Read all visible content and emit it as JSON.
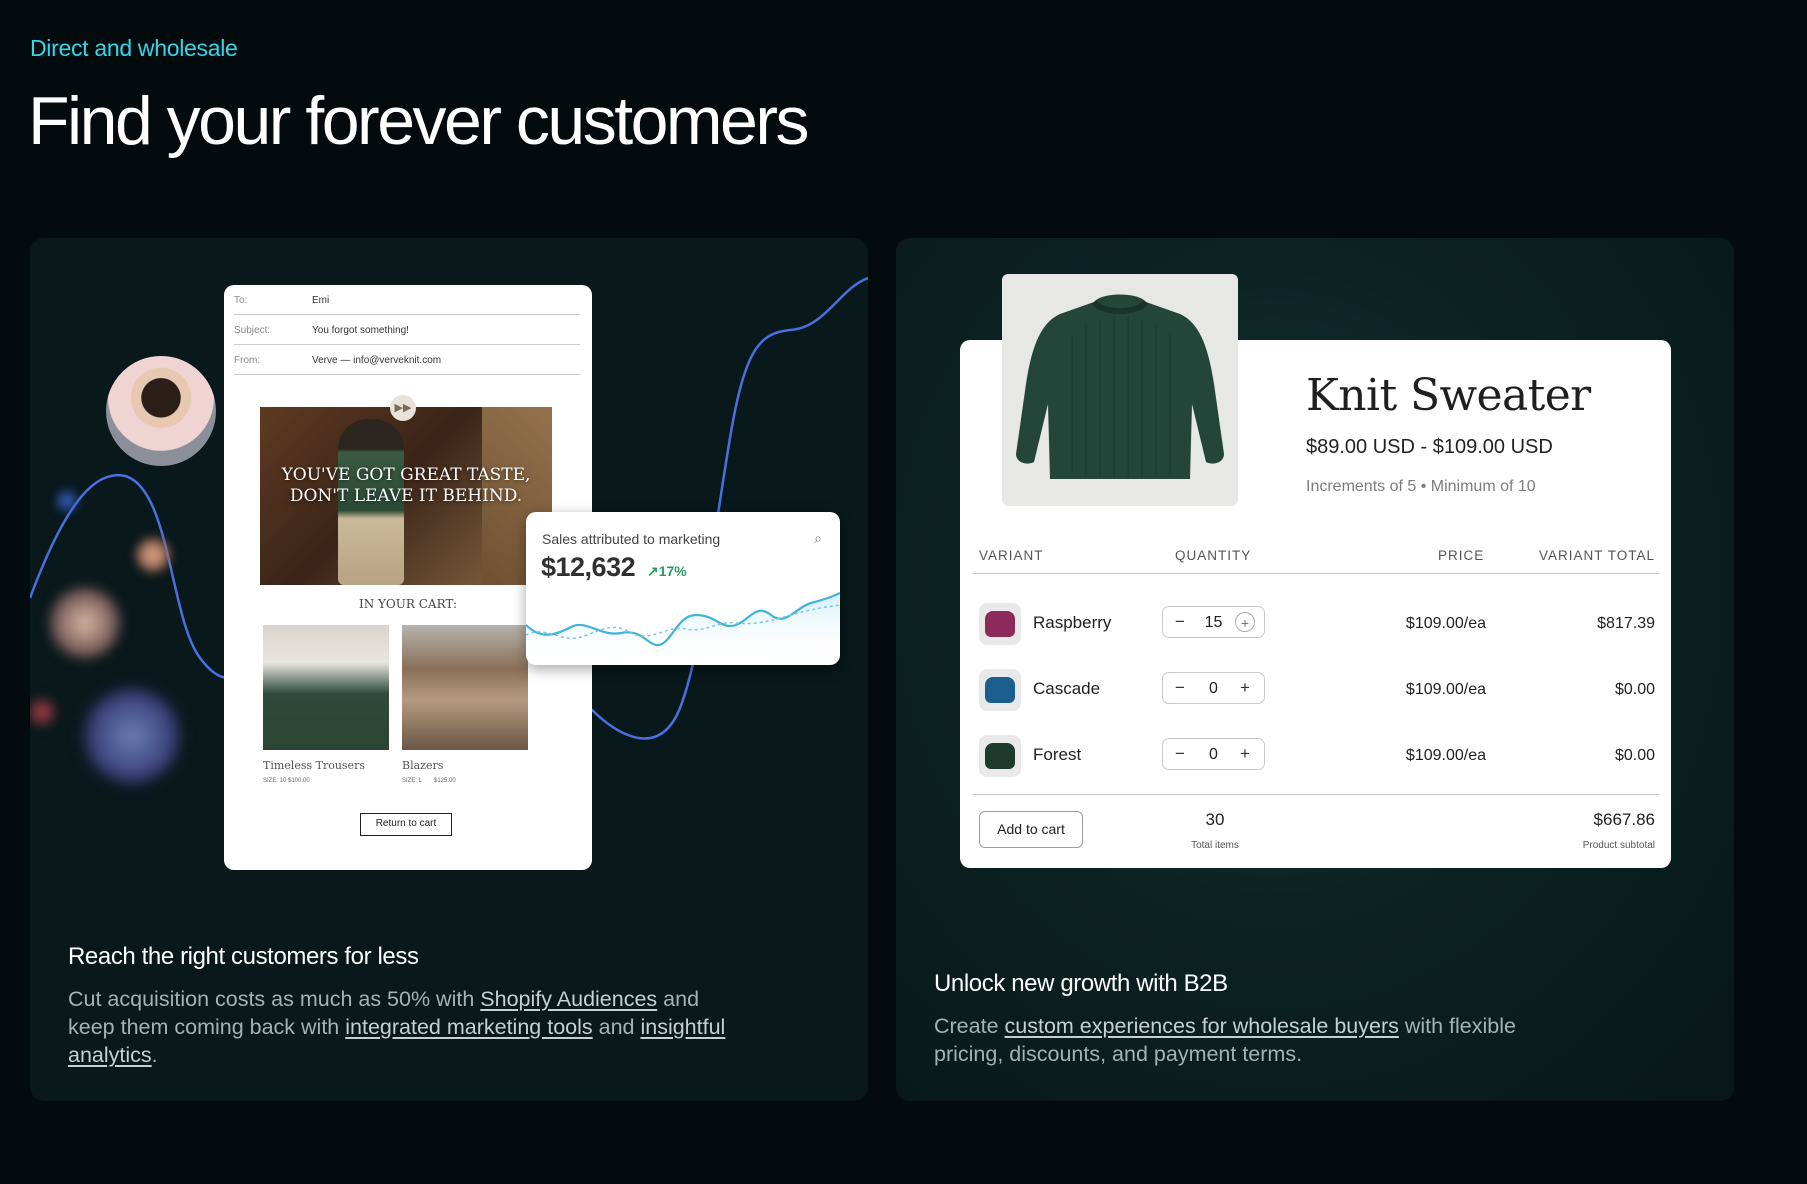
{
  "header": {
    "eyebrow": "Direct and wholesale",
    "headline": "Find your forever customers"
  },
  "left_card": {
    "email": {
      "to_label": "To:",
      "to_value": "Emi",
      "subject_label": "Subject:",
      "subject_value": "You forgot something!",
      "from_label": "From:",
      "from_value": "Verve — info@verveknit.com",
      "hero_text": "YOU'VE GOT GREAT TASTE, DON'T LEAVE IT BEHIND.",
      "cart_heading": "IN YOUR CART:",
      "products": [
        {
          "name": "Timeless Trousers",
          "size": "SIZE: 10",
          "price": "$100.00"
        },
        {
          "name": "Blazers",
          "size": "SIZE: L",
          "price": "$125.00"
        }
      ],
      "return_button": "Return to cart"
    },
    "sales_widget": {
      "title": "Sales attributed to marketing",
      "value": "$12,632",
      "delta": "17%",
      "icon": "search-chart-icon"
    },
    "title": "Reach the right customers for less",
    "body_1": "Cut acquisition costs as much as 50% with ",
    "link_1": "Shopify Audiences",
    "body_2": " and keep them coming back with ",
    "link_2": "integrated marketing tools",
    "body_3": " and ",
    "link_3": "insightful analytics",
    "body_4": "."
  },
  "right_card": {
    "product": {
      "title": "Knit Sweater",
      "price_range": "$89.00 USD - $109.00 USD",
      "meta": "Increments of 5 • Minimum of 10",
      "columns": [
        "VARIANT",
        "QUANTITY",
        "PRICE",
        "VARIANT TOTAL"
      ],
      "variants": [
        {
          "name": "Raspberry",
          "qty": "15",
          "price": "$109.00/ea",
          "total": "$817.39",
          "color": "#8c2a5c"
        },
        {
          "name": "Cascade",
          "qty": "0",
          "price": "$109.00/ea",
          "total": "$0.00",
          "color": "#1c5f8f"
        },
        {
          "name": "Forest",
          "qty": "0",
          "price": "$109.00/ea",
          "total": "$0.00",
          "color": "#1e3a2c"
        }
      ],
      "add_to_cart": "Add to cart",
      "total_items": "30",
      "total_items_label": "Total items",
      "subtotal": "$667.86",
      "subtotal_label": "Product subtotal",
      "minus_symbol": "−",
      "plus_symbol": "+"
    },
    "title": "Unlock new growth with B2B",
    "body_1": "Create ",
    "link_1": "custom experiences for wholesale buyers",
    "body_2": " with flexible pricing, discounts, and payment terms."
  },
  "colors": {
    "accent": "#35d6e8",
    "background": "#030b0e",
    "wave": "#4a6fe0",
    "chart_line": "#3fb3d8",
    "positive": "#2c9a5f"
  }
}
